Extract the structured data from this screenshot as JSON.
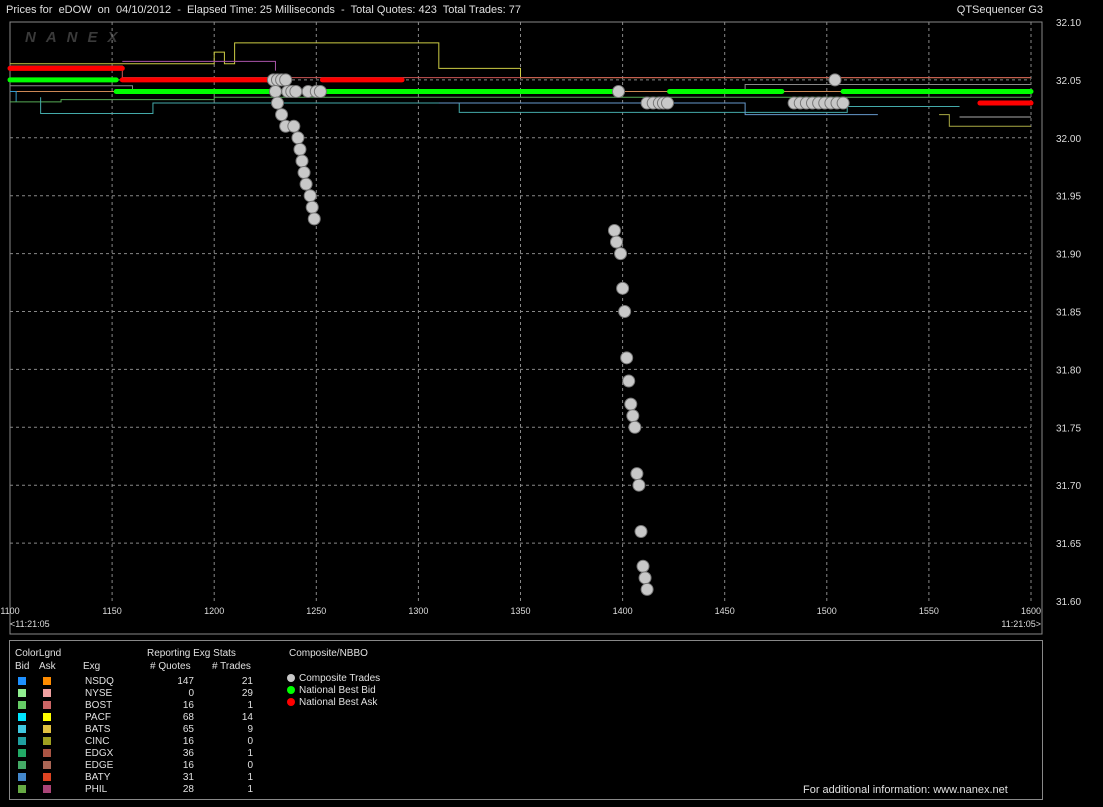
{
  "header": {
    "title": "Prices for  eDOW  on  04/10/2012  -  Elapsed Time: 25 Milliseconds  -  Total Quotes: 423  Total Trades: 77",
    "app_name": "QTSequencer G3",
    "watermark": "NANEX"
  },
  "chart_data": {
    "type": "scatter",
    "x_range": [
      1100,
      1600
    ],
    "y_range": [
      31.6,
      32.1
    ],
    "x_ticks": [
      1100,
      1150,
      1200,
      1250,
      1300,
      1350,
      1400,
      1450,
      1500,
      1550,
      1600
    ],
    "y_ticks": [
      "32.10",
      "32.05",
      "32.00",
      "31.95",
      "31.90",
      "31.85",
      "31.80",
      "31.75",
      "31.70",
      "31.65",
      "31.60"
    ],
    "x_start_label": "<11:21:05",
    "x_end_label": "11:21:05>",
    "grid": true,
    "colors": {
      "trades": "#c8c8c8",
      "bid": "#00ff00",
      "ask": "#ff0000"
    },
    "trades": [
      {
        "x": 1229,
        "y": 32.05
      },
      {
        "x": 1231,
        "y": 32.05
      },
      {
        "x": 1233,
        "y": 32.05
      },
      {
        "x": 1235,
        "y": 32.05
      },
      {
        "x": 1230,
        "y": 32.04
      },
      {
        "x": 1236,
        "y": 32.04
      },
      {
        "x": 1238,
        "y": 32.04
      },
      {
        "x": 1240,
        "y": 32.04
      },
      {
        "x": 1246,
        "y": 32.04
      },
      {
        "x": 1250,
        "y": 32.04
      },
      {
        "x": 1252,
        "y": 32.04
      },
      {
        "x": 1231,
        "y": 32.03
      },
      {
        "x": 1233,
        "y": 32.02
      },
      {
        "x": 1235,
        "y": 32.01
      },
      {
        "x": 1239,
        "y": 32.01
      },
      {
        "x": 1241,
        "y": 32.0
      },
      {
        "x": 1242,
        "y": 31.99
      },
      {
        "x": 1243,
        "y": 31.98
      },
      {
        "x": 1244,
        "y": 31.97
      },
      {
        "x": 1245,
        "y": 31.96
      },
      {
        "x": 1247,
        "y": 31.95
      },
      {
        "x": 1248,
        "y": 31.94
      },
      {
        "x": 1249,
        "y": 31.93
      },
      {
        "x": 1396,
        "y": 31.92
      },
      {
        "x": 1397,
        "y": 31.91
      },
      {
        "x": 1399,
        "y": 31.9
      },
      {
        "x": 1400,
        "y": 31.87
      },
      {
        "x": 1401,
        "y": 31.85
      },
      {
        "x": 1402,
        "y": 31.81
      },
      {
        "x": 1403,
        "y": 31.79
      },
      {
        "x": 1404,
        "y": 31.77
      },
      {
        "x": 1405,
        "y": 31.76
      },
      {
        "x": 1406,
        "y": 31.75
      },
      {
        "x": 1407,
        "y": 31.71
      },
      {
        "x": 1408,
        "y": 31.7
      },
      {
        "x": 1409,
        "y": 31.66
      },
      {
        "x": 1410,
        "y": 31.63
      },
      {
        "x": 1411,
        "y": 31.62
      },
      {
        "x": 1412,
        "y": 31.61
      },
      {
        "x": 1398,
        "y": 32.04
      },
      {
        "x": 1412,
        "y": 32.03
      },
      {
        "x": 1415,
        "y": 32.03
      },
      {
        "x": 1418,
        "y": 32.03
      },
      {
        "x": 1420,
        "y": 32.03
      },
      {
        "x": 1422,
        "y": 32.03
      },
      {
        "x": 1504,
        "y": 32.05
      },
      {
        "x": 1484,
        "y": 32.03
      },
      {
        "x": 1487,
        "y": 32.03
      },
      {
        "x": 1490,
        "y": 32.03
      },
      {
        "x": 1493,
        "y": 32.03
      },
      {
        "x": 1496,
        "y": 32.03
      },
      {
        "x": 1499,
        "y": 32.03
      },
      {
        "x": 1502,
        "y": 32.03
      },
      {
        "x": 1505,
        "y": 32.03
      },
      {
        "x": 1508,
        "y": 32.03
      }
    ],
    "national_best_bid": [
      {
        "x0": 1100,
        "x1": 1152,
        "y": 32.05
      },
      {
        "x0": 1152,
        "x1": 1398,
        "y": 32.04
      },
      {
        "x0": 1423,
        "x1": 1478,
        "y": 32.04
      },
      {
        "x0": 1508,
        "x1": 1600,
        "y": 32.04
      }
    ],
    "national_best_ask": [
      {
        "x0": 1100,
        "x1": 1155,
        "y": 32.06
      },
      {
        "x0": 1155,
        "x1": 1228,
        "y": 32.05
      },
      {
        "x0": 1253,
        "x1": 1292,
        "y": 32.05
      },
      {
        "x0": 1575,
        "x1": 1600,
        "y": 32.03
      }
    ],
    "exchange_quotes": [
      {
        "color": "#cccc44",
        "points": [
          [
            1100,
            32.064
          ],
          [
            1200,
            32.064
          ],
          [
            1200,
            32.074
          ],
          [
            1205,
            32.074
          ],
          [
            1205,
            32.064
          ],
          [
            1210,
            32.064
          ],
          [
            1210,
            32.082
          ],
          [
            1310,
            32.082
          ],
          [
            1310,
            32.06
          ],
          [
            1350,
            32.06
          ],
          [
            1350,
            32.052
          ],
          [
            1600,
            32.052
          ]
        ]
      },
      {
        "color": "#cc5555",
        "points": [
          [
            1100,
            32.062
          ],
          [
            1155,
            32.062
          ],
          [
            1155,
            32.052
          ],
          [
            1600,
            32.052
          ]
        ]
      },
      {
        "color": "#aa55aa",
        "points": [
          [
            1155,
            32.066
          ],
          [
            1230,
            32.066
          ],
          [
            1230,
            32.058
          ]
        ]
      },
      {
        "color": "#888888",
        "points": [
          [
            1100,
            32.045
          ],
          [
            1160,
            32.045
          ],
          [
            1160,
            32.04
          ],
          [
            1460,
            32.04
          ],
          [
            1460,
            32.046
          ],
          [
            1600,
            32.046
          ]
        ]
      },
      {
        "color": "#cc8855",
        "points": [
          [
            1100,
            32.04
          ],
          [
            1600,
            32.04
          ]
        ]
      },
      {
        "color": "#3399cc",
        "points": [
          [
            1103,
            32.031
          ],
          [
            1103,
            32.04
          ],
          [
            1100,
            32.04
          ]
        ]
      },
      {
        "color": "#55aa55",
        "points": [
          [
            1100,
            32.031
          ],
          [
            1125,
            32.031
          ],
          [
            1125,
            32.033
          ],
          [
            1200,
            32.033
          ],
          [
            1200,
            32.035
          ],
          [
            1600,
            32.035
          ]
        ]
      },
      {
        "color": "#44aaaa",
        "points": [
          [
            1115,
            32.035
          ],
          [
            1115,
            32.021
          ],
          [
            1170,
            32.021
          ],
          [
            1170,
            32.03
          ],
          [
            1320,
            32.03
          ],
          [
            1320,
            32.022
          ],
          [
            1510,
            32.022
          ],
          [
            1510,
            32.027
          ],
          [
            1565,
            32.027
          ]
        ]
      },
      {
        "color": "#6699cc",
        "points": [
          [
            1310,
            32.03
          ],
          [
            1460,
            32.03
          ],
          [
            1460,
            32.02
          ],
          [
            1525,
            32.02
          ]
        ]
      },
      {
        "color": "#aaaa44",
        "points": [
          [
            1555,
            32.02
          ],
          [
            1560,
            32.02
          ],
          [
            1560,
            32.01
          ],
          [
            1600,
            32.01
          ]
        ]
      },
      {
        "color": "#aaaaaa",
        "points": [
          [
            1565,
            32.018
          ],
          [
            1600,
            32.018
          ]
        ]
      }
    ]
  },
  "legend": {
    "color_legend_title": "ColorLgnd",
    "bid_header": "Bid",
    "ask_header": "Ask",
    "exchange_header": "Exg",
    "stats_title": "Reporting Exg Stats",
    "quotes_header": "# Quotes",
    "trades_header": "# Trades",
    "composite_title": "Composite/NBBO",
    "composite_items": [
      {
        "label": "Composite Trades",
        "color": "#c8c8c8"
      },
      {
        "label": "National Best Bid",
        "color": "#00ff00"
      },
      {
        "label": "National Best Ask",
        "color": "#ff0000"
      }
    ],
    "exchanges": [
      {
        "name": "NSDQ",
        "bid_color": "#1e90ff",
        "ask_color": "#ff8c00",
        "quotes": "147",
        "trades": "21"
      },
      {
        "name": "NYSE",
        "bid_color": "#90ee90",
        "ask_color": "#f0a0a0",
        "quotes": "0",
        "trades": "29"
      },
      {
        "name": "BOST",
        "bid_color": "#66cc66",
        "ask_color": "#cc6666",
        "quotes": "16",
        "trades": "1"
      },
      {
        "name": "PACF",
        "bid_color": "#00e5ff",
        "ask_color": "#ffff00",
        "quotes": "68",
        "trades": "14"
      },
      {
        "name": "BATS",
        "bid_color": "#40c8e0",
        "ask_color": "#e0c040",
        "quotes": "65",
        "trades": "9"
      },
      {
        "name": "CINC",
        "bid_color": "#20a0a0",
        "ask_color": "#a0a020",
        "quotes": "16",
        "trades": "0"
      },
      {
        "name": "EDGX",
        "bid_color": "#22aa66",
        "ask_color": "#aa5544",
        "quotes": "36",
        "trades": "1"
      },
      {
        "name": "EDGE",
        "bid_color": "#44aa66",
        "ask_color": "#aa6655",
        "quotes": "16",
        "trades": "0"
      },
      {
        "name": "BATY",
        "bid_color": "#4488cc",
        "ask_color": "#dd4422",
        "quotes": "31",
        "trades": "1"
      },
      {
        "name": "PHIL",
        "bid_color": "#66aa44",
        "ask_color": "#aa4477",
        "quotes": "28",
        "trades": "1"
      }
    ],
    "footer": "For additional information: www.nanex.net"
  }
}
